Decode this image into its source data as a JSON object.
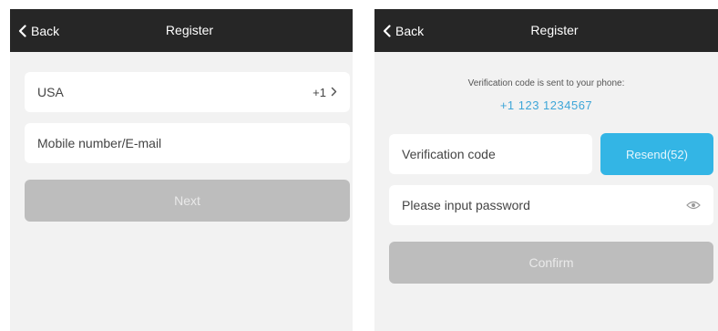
{
  "left_screen": {
    "navbar": {
      "back_label": "Back",
      "title": "Register"
    },
    "country": {
      "name": "USA",
      "code": "+1"
    },
    "account_input": {
      "placeholder": "Mobile number/E-mail"
    },
    "next_button": {
      "label": "Next"
    }
  },
  "right_screen": {
    "navbar": {
      "back_label": "Back",
      "title": "Register"
    },
    "info_text": "Verification code is sent to your phone:",
    "phone_number": "+1 123 1234567",
    "verification_input": {
      "placeholder": "Verification code"
    },
    "resend_button": {
      "label": "Resend(52)"
    },
    "password_input": {
      "placeholder": "Please input password"
    },
    "confirm_button": {
      "label": "Confirm"
    }
  },
  "colors": {
    "navbar_bg": "#262626",
    "screen_bg": "#f2f2f2",
    "disabled_button": "#bdbdbd",
    "accent": "#33b5e5",
    "phone_text": "#3ea6d8"
  },
  "icons": {
    "back": "chevron-left-icon",
    "country_arrow": "chevron-right-icon",
    "password_toggle": "eye-icon"
  }
}
